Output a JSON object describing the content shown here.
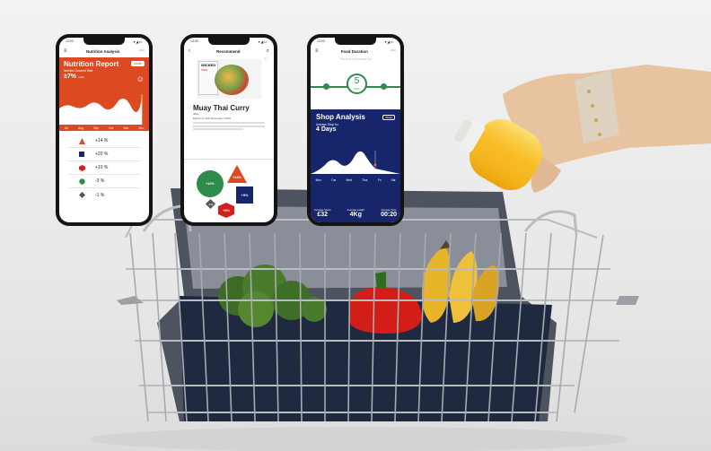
{
  "phone_nutrition": {
    "status_time": "13:00",
    "title": "Nutrition Analysis",
    "report_title": "Nutrition Report",
    "period": "Month",
    "subtitle": "Nutrition Covered Rate",
    "value": "±7%",
    "value_unit": "(null)",
    "months": [
      "Jul",
      "Aug",
      "Sep",
      "Oct",
      "Nov",
      "Dec"
    ],
    "legend": [
      {
        "shape": "triangle",
        "color": "#dc4a22",
        "value": "+14 %"
      },
      {
        "shape": "square",
        "color": "#17266b",
        "value": "+20 %"
      },
      {
        "shape": "hexagon",
        "color": "#d11f1f",
        "value": "+10 %"
      },
      {
        "shape": "circle",
        "color": "#2e8b4b",
        "value": "-3 %"
      },
      {
        "shape": "diamond",
        "color": "#555555",
        "value": "-1 %"
      }
    ]
  },
  "phone_recommend": {
    "status_time": "13:00",
    "title": "Recommend",
    "pack_brand": "WICKED",
    "pack_sub": "THAI",
    "recipe_name": "Muay Thai Curry",
    "meta1": "400g",
    "meta2": "Expire on 11th December, 2019",
    "bubbles": [
      {
        "label": "+12%",
        "color": "#2e8b4b",
        "shape": "circle"
      },
      {
        "label": "+14%",
        "color": "#dc4a22",
        "shape": "triangle"
      },
      {
        "label": "+9%",
        "color": "#17266b",
        "shape": "square"
      },
      {
        "label": "-1%",
        "color": "#555555",
        "shape": "diamond"
      },
      {
        "label": "+5%",
        "color": "#d11f1f",
        "shape": "hexagon"
      }
    ]
  },
  "phone_duration": {
    "status_time": "13:00",
    "title": "Food Duration",
    "question": "This time of purchase for",
    "days_number": "5",
    "days_label": "Days",
    "section_title": "Shop Analysis",
    "period": "Week",
    "avg_label": "Average Shop for",
    "avg_value": "4 Days",
    "days": [
      "Mon",
      "Tue",
      "Wed",
      "Thur",
      "Fri",
      "Sat"
    ],
    "stats": [
      {
        "label": "Average Spent",
        "value": "£32"
      },
      {
        "label": "Average weight",
        "value": "4Kg"
      },
      {
        "label": "Average Time",
        "value": "00:20"
      }
    ]
  },
  "colors": {
    "orange": "#dc4a22",
    "navy": "#17266b",
    "green": "#2e8b4b"
  }
}
